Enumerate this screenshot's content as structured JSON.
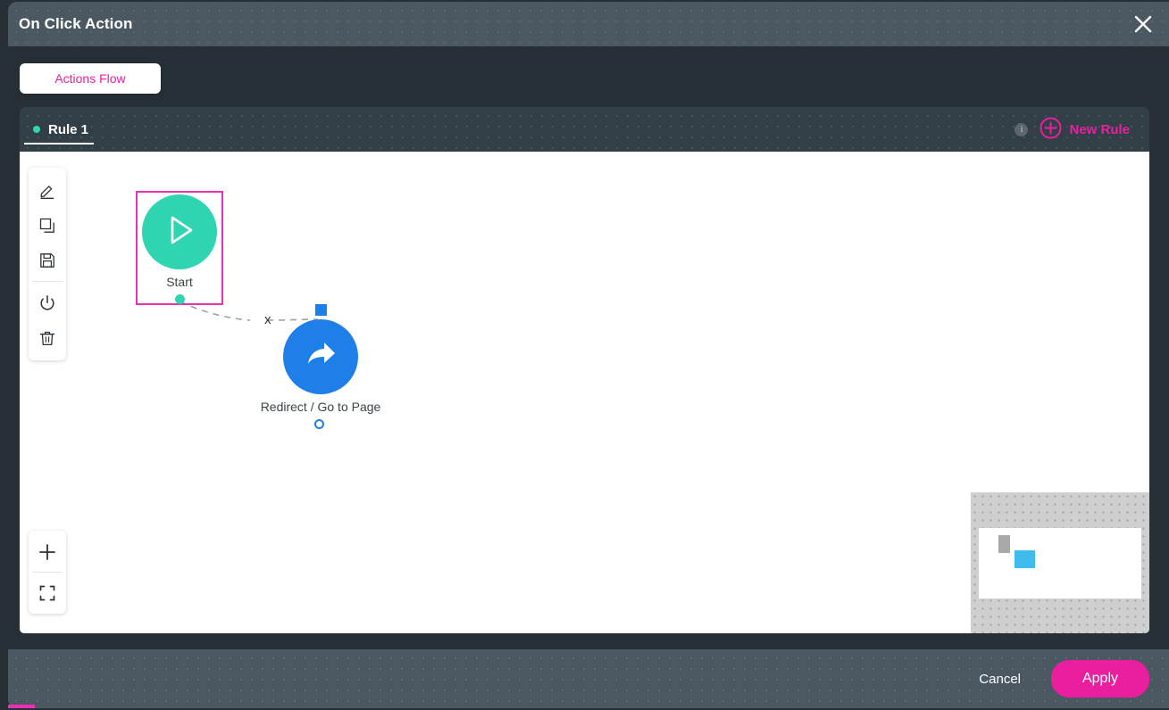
{
  "window": {
    "title": "On Click Action",
    "close_icon": "close-icon"
  },
  "subtabs": {
    "actions_flow_label": "Actions Flow"
  },
  "rulebar": {
    "rule_label": "Rule 1",
    "rule_status_color": "#2fd5b0",
    "info_icon_char": "i",
    "new_rule_label": "New Rule",
    "accent_color": "#e91fa0"
  },
  "toolbar": {
    "items": [
      {
        "name": "edit-icon",
        "title": "Edit"
      },
      {
        "name": "duplicate-icon",
        "title": "Duplicate"
      },
      {
        "name": "save-icon",
        "title": "Save"
      },
      {
        "name": "power-icon",
        "title": "Enable / Disable"
      },
      {
        "name": "delete-icon",
        "title": "Delete"
      }
    ]
  },
  "zoom_controls": {
    "zoom_in_label": "+",
    "fit_icon": "fit-to-screen-icon"
  },
  "canvas": {
    "nodes": [
      {
        "id": "start",
        "label": "Start",
        "icon": "play-icon",
        "color": "#2fd5b0",
        "selected": true
      },
      {
        "id": "redirect",
        "label": "Redirect / Go to Page",
        "icon": "share-arrow-icon",
        "color": "#1f7fe8",
        "selected": false
      }
    ],
    "edge": {
      "from": "start",
      "to": "redirect",
      "delete_marker": "x",
      "style": "dashed",
      "color": "#9aa3a9"
    }
  },
  "minimap": {
    "nodes": [
      {
        "name": "minimap-node-start",
        "color": "#a9a9a9"
      },
      {
        "name": "minimap-node-redirect",
        "color": "#3fbbee"
      }
    ]
  },
  "footer": {
    "cancel_label": "Cancel",
    "apply_label": "Apply",
    "apply_color": "#e91fa0"
  }
}
